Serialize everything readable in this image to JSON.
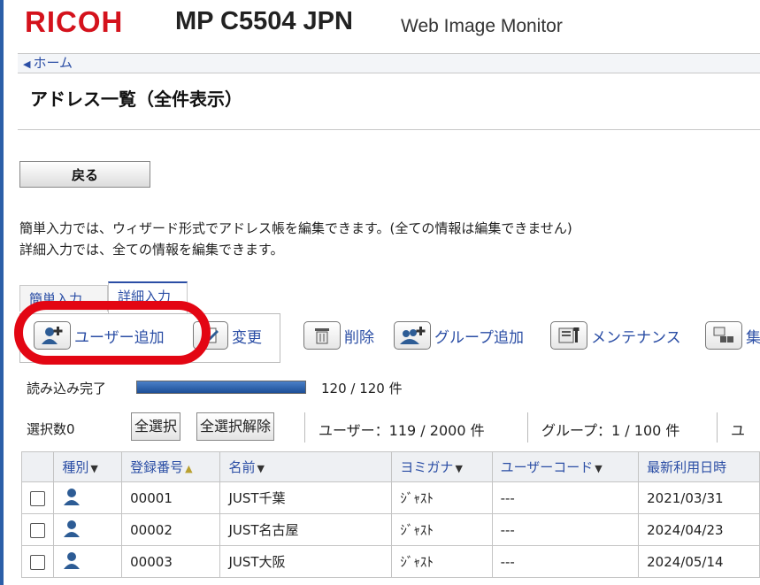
{
  "header": {
    "logo": "RICOH",
    "model": "MP C5504 JPN",
    "product": "Web Image Monitor"
  },
  "breadcrumb": {
    "home_label": "ホーム"
  },
  "page": {
    "title": "アドレス一覧（全件表示）"
  },
  "back_button": "戻る",
  "description": {
    "line1": "簡単入力では、ウィザード形式でアドレス帳を編集できます。(全ての情報は編集できません)",
    "line2": "詳細入力では、全ての情報を編集できます。"
  },
  "tabs": [
    {
      "label": "簡単入力"
    },
    {
      "label": "詳細入力"
    }
  ],
  "toolbar": {
    "add_user": "ユーザー追加",
    "change": "変更",
    "delete": "削除",
    "add_group": "グループ追加",
    "maintenance": "メンテナンス",
    "more": "集"
  },
  "loading": {
    "label": "読み込み完了",
    "progress": 1.0,
    "count": "120 / 120 件"
  },
  "selection": {
    "count_label": "選択数0",
    "select_all": "全選択",
    "deselect_all": "全選択解除",
    "users": "ユーザー：119 / 2000 件",
    "groups": "グループ：1 / 100 件",
    "more": "ユ"
  },
  "table": {
    "columns": [
      "種別",
      "登録番号",
      "名前",
      "ヨミガナ",
      "ユーザーコード",
      "最新利用日時"
    ],
    "rows": [
      {
        "id": "00001",
        "name": "JUST千葉",
        "kana": "ｼﾞｬｽﾄ",
        "code": "---",
        "date": "2021/03/31"
      },
      {
        "id": "00002",
        "name": "JUST名古屋",
        "kana": "ｼﾞｬｽﾄ",
        "code": "---",
        "date": "2024/04/23"
      },
      {
        "id": "00003",
        "name": "JUST大阪",
        "kana": "ｼﾞｬｽﾄ",
        "code": "---",
        "date": "2024/05/14"
      }
    ]
  },
  "colors": {
    "brand_red": "#d4121c",
    "link_blue": "#2b4ea5",
    "annotation_red": "#e30613",
    "progress_blue": "#1c4e96"
  }
}
